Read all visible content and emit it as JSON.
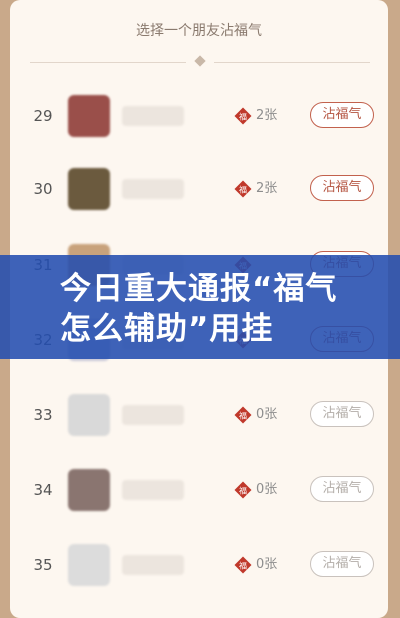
{
  "header": {
    "title": "选择一个朋友沾福气"
  },
  "rows": [
    {
      "rank": "29",
      "count": "2张",
      "button": "沾福气",
      "active": true
    },
    {
      "rank": "30",
      "count": "2张",
      "button": "沾福气",
      "active": true
    },
    {
      "rank": "31",
      "count": "",
      "button": "沾福气",
      "active": true
    },
    {
      "rank": "32",
      "count": "",
      "button": "沾福气",
      "active": true
    },
    {
      "rank": "33",
      "count": "0张",
      "button": "沾福气",
      "active": false
    },
    {
      "rank": "34",
      "count": "0张",
      "button": "沾福气",
      "active": false
    },
    {
      "rank": "35",
      "count": "0张",
      "button": "沾福气",
      "active": false
    }
  ],
  "banner": {
    "text": "今日重大通报“福气怎么辅助”用挂"
  },
  "colors": {
    "accent": "#b4533f",
    "banner": "#234daf",
    "background": "#fdf7f0"
  }
}
